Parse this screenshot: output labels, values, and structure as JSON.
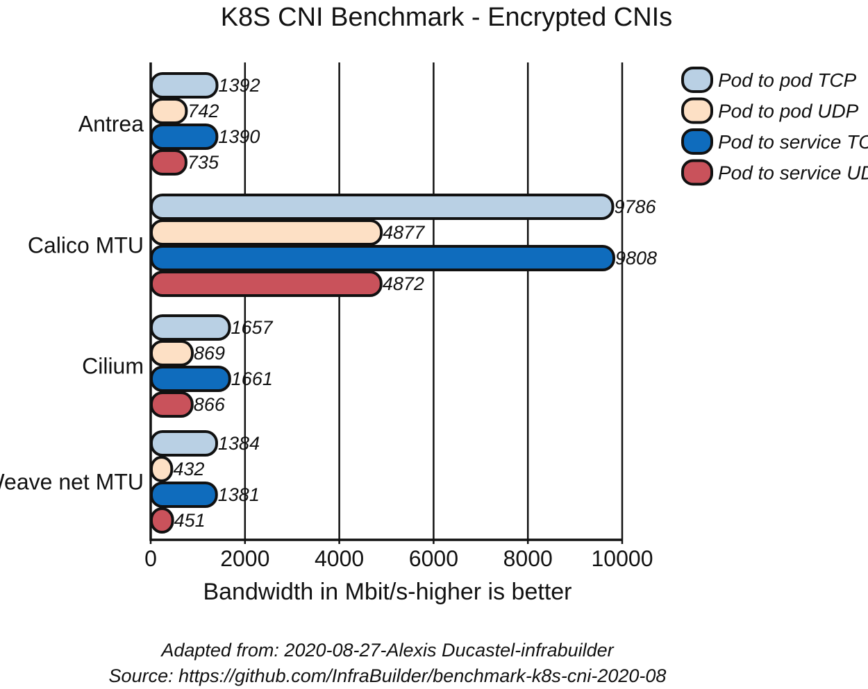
{
  "chart_data": {
    "type": "bar",
    "orientation": "horizontal",
    "title": "K8S CNI Benchmark - Encrypted CNIs",
    "xlabel": "Bandwidth in Mbit/s-higher is better",
    "ylabel": "",
    "xlim": [
      0,
      10000
    ],
    "xticks": [
      0,
      2000,
      4000,
      6000,
      8000,
      10000
    ],
    "xtick_labels": [
      "0",
      "2000",
      "4000",
      "6000",
      "8000",
      "10000"
    ],
    "grid": "vertical",
    "legend_position": "top-right",
    "categories": [
      "Antrea",
      "Calico MTU",
      "Cilium",
      "Weave net MTU"
    ],
    "series": [
      {
        "name": "Pod to pod TCP",
        "color": "#b9d0e4",
        "values": [
          1392,
          9786,
          1657,
          1384
        ]
      },
      {
        "name": "Pod to pod UDP",
        "color": "#fde0c5",
        "values": [
          742,
          4877,
          869,
          432
        ]
      },
      {
        "name": "Pod to service TCP",
        "color": "#0f6cbd",
        "values": [
          1390,
          9808,
          1661,
          1381
        ]
      },
      {
        "name": "Pod to service UDP",
        "color": "#c9525b",
        "values": [
          735,
          4872,
          866,
          451
        ]
      }
    ],
    "annotations": [
      "Adapted from: 2020-08-27-Alexis Ducastel-infrabuilder",
      "Source: https://github.com/InfraBuilder/benchmark-k8s-cni-2020-08"
    ]
  }
}
